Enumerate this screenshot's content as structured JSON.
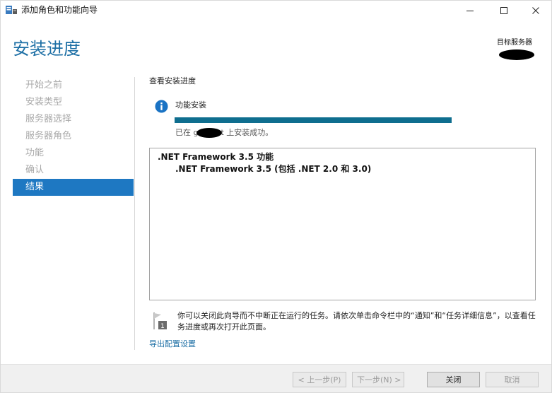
{
  "window": {
    "title": "添加角色和功能向导"
  },
  "header": {
    "page_title": "安装进度",
    "server_label": "目标服务器"
  },
  "nav": {
    "items": [
      {
        "label": "开始之前",
        "active": false
      },
      {
        "label": "安装类型",
        "active": false
      },
      {
        "label": "服务器选择",
        "active": false
      },
      {
        "label": "服务器角色",
        "active": false
      },
      {
        "label": "功能",
        "active": false
      },
      {
        "label": "确认",
        "active": false
      },
      {
        "label": "结果",
        "active": true
      }
    ]
  },
  "main": {
    "section_heading": "查看安装进度",
    "feature_label": "功能安装",
    "progress_percent": 100,
    "status_prefix": "已在 g",
    "status_suffix": "t 上安装成功。",
    "results": {
      "title": ".NET Framework 3.5 功能",
      "sub": ".NET Framework 3.5 (包括 .NET 2.0 和 3.0)"
    },
    "note": "你可以关闭此向导而不中断正在运行的任务。请依次单击命令栏中的“通知”和“任务详细信息”，以查看任务进度或再次打开此页面。",
    "export_link": "导出配置设置"
  },
  "footer": {
    "prev_label": "< 上一步(P)",
    "next_label": "下一步(N) >",
    "close_label": "关闭",
    "cancel_label": "取消"
  },
  "colors": {
    "accent": "#1d6fa5",
    "nav_active": "#1e78c2",
    "progress": "#0f6e8f",
    "info_icon": "#1a73c4"
  },
  "icons": {
    "app": "server-manager-icon",
    "info": "info-icon",
    "note": "flag-notification-icon",
    "minimize": "minimize-icon",
    "maximize": "maximize-icon",
    "close": "close-icon"
  }
}
